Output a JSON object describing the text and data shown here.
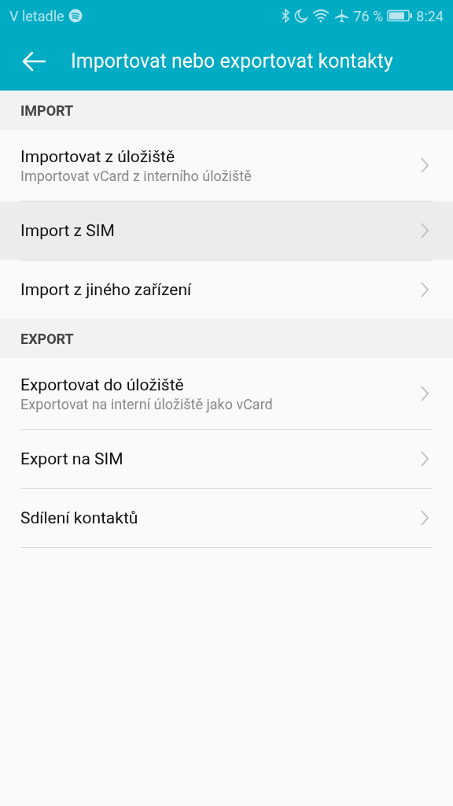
{
  "status_bar": {
    "carrier": "V letadle",
    "battery": "76 %",
    "time": "8:24"
  },
  "app_bar": {
    "title": "Importovat nebo exportovat kontakty"
  },
  "sections": [
    {
      "header": "IMPORT",
      "items": [
        {
          "title": "Importovat z úložiště",
          "subtitle": "Importovat vCard z interního úložiště",
          "selected": false
        },
        {
          "title": "Import z SIM",
          "selected": true
        },
        {
          "title": "Import z jiného zařízení",
          "selected": false
        }
      ]
    },
    {
      "header": "EXPORT",
      "items": [
        {
          "title": "Exportovat do úložiště",
          "subtitle": "Exportovat na interní úložiště jako vCard",
          "selected": false
        },
        {
          "title": "Export na SIM",
          "selected": false
        },
        {
          "title": "Sdílení kontaktů",
          "selected": false
        }
      ]
    }
  ]
}
